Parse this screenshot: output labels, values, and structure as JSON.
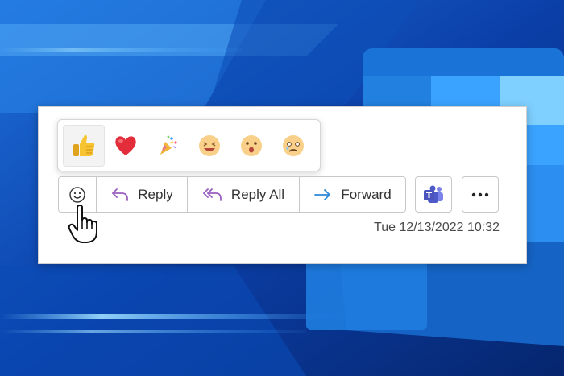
{
  "reactions": {
    "items": [
      {
        "name": "like",
        "icon": "thumbs-up-icon",
        "selected": true
      },
      {
        "name": "heart",
        "icon": "heart-icon",
        "selected": false
      },
      {
        "name": "celebrate",
        "icon": "party-popper-icon",
        "selected": false
      },
      {
        "name": "laugh",
        "icon": "laughing-face-icon",
        "selected": false
      },
      {
        "name": "surprised",
        "icon": "surprised-face-icon",
        "selected": false
      },
      {
        "name": "sad",
        "icon": "sad-face-icon",
        "selected": false
      }
    ]
  },
  "toolbar": {
    "reply_label": "Reply",
    "reply_all_label": "Reply All",
    "forward_label": "Forward"
  },
  "message": {
    "timestamp": "Tue 12/13/2022 10:32"
  },
  "colors": {
    "accent_purple": "#9b5fc0",
    "forward_arrow": "#2b88d8",
    "teams_purple": "#5059c9"
  }
}
